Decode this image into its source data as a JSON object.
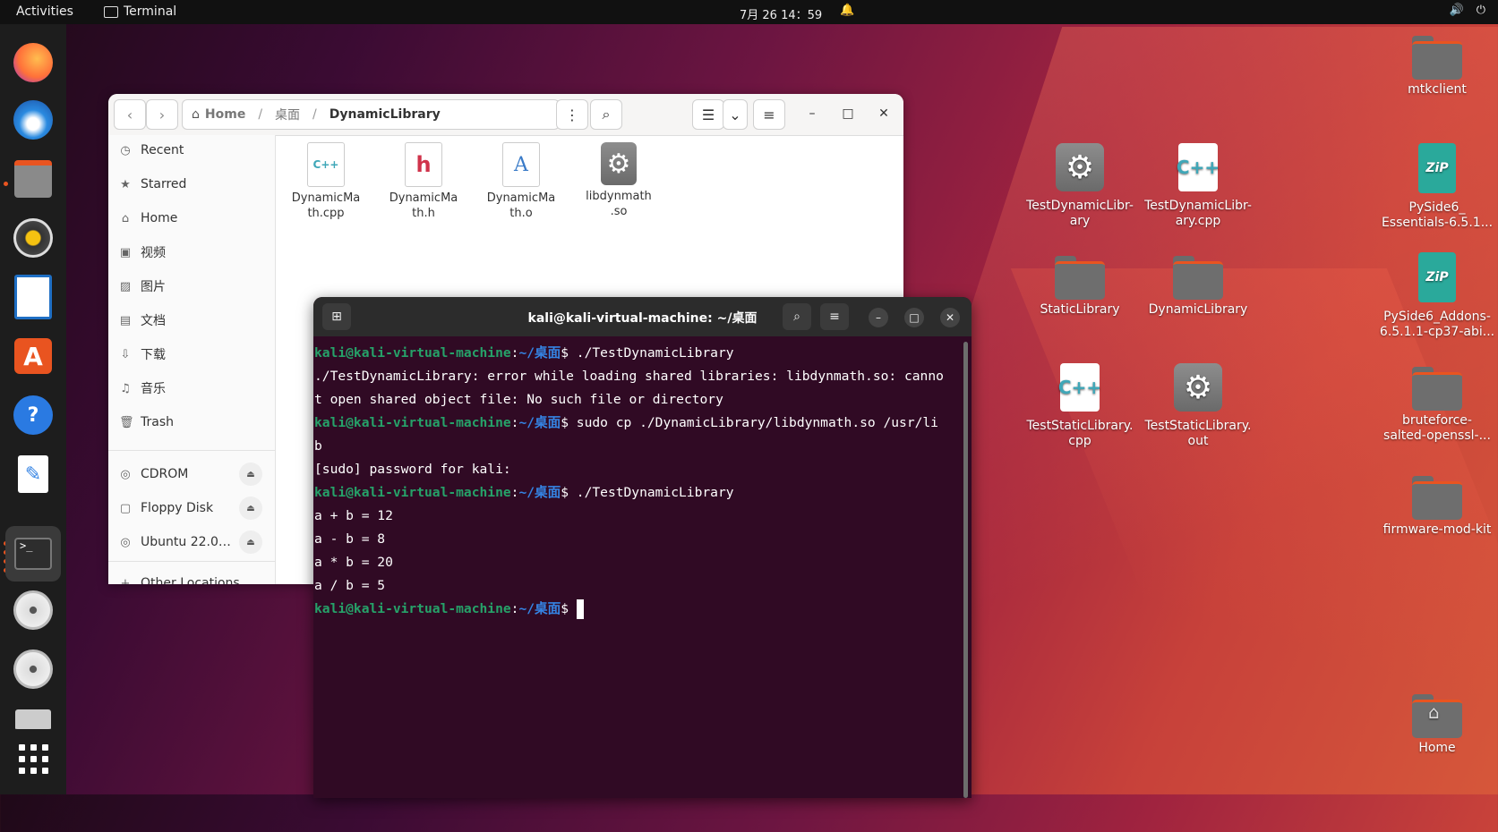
{
  "topbar": {
    "activities": "Activities",
    "app_name": "Terminal",
    "clock": "7月 26 14：59"
  },
  "dock": {
    "items": [
      "firefox-icon",
      "thunderbird-icon",
      "files-icon",
      "rhythmbox-icon",
      "writer-icon",
      "app-center-icon",
      "help-icon",
      "text-editor-icon",
      "terminal-icon",
      "cdrom-icon",
      "dvd-icon",
      "disk-icon",
      "show-apps-icon"
    ]
  },
  "files_window": {
    "path": {
      "home": "Home",
      "desktop": "桌面",
      "current": "DynamicLibrary"
    },
    "sidebar": {
      "recent": "Recent",
      "starred": "Starred",
      "home": "Home",
      "videos": "视频",
      "pictures": "图片",
      "documents": "文档",
      "downloads": "下载",
      "music": "音乐",
      "trash": "Trash",
      "cdrom": "CDROM",
      "floppy": "Floppy Disk",
      "ubuntu": "Ubuntu 22.0…",
      "other": "Other Locations"
    },
    "files": [
      {
        "line1": "DynamicMa",
        "line2": "th.cpp",
        "badge": "C++"
      },
      {
        "line1": "DynamicMa",
        "line2": "th.h",
        "badge": "h"
      },
      {
        "line1": "DynamicMa",
        "line2": "th.o",
        "badge": "A"
      },
      {
        "line1": "libdynmath",
        "line2": ".so",
        "badge": "⚙"
      }
    ]
  },
  "terminal": {
    "title": "kali@kali-virtual-machine: ~/桌面",
    "prompt_user": "kali@kali-virtual-machine",
    "prompt_path": "~/桌面",
    "lines": {
      "cmd1": " ./TestDynamicLibrary",
      "err1": "./TestDynamicLibrary: error while loading shared libraries: libdynmath.so: canno",
      "err2": "t open shared object file: No such file or directory",
      "cmd2": " sudo cp ./DynamicLibrary/libdynmath.so /usr/li",
      "cmd2b": "b",
      "sudo": "[sudo] password for kali:",
      "cmd3": " ./TestDynamicLibrary",
      "out1": "a + b = 12",
      "out2": "a - b = 8",
      "out3": "a * b = 20",
      "out4": "a / b = 5"
    }
  },
  "desktop": {
    "mtkclient": "mtkclient",
    "testdyn1": "TestDynamicLibr-",
    "testdyn2": "ary",
    "testdyncpp1": "TestDynamicLibr-",
    "testdyncpp2": "ary.cpp",
    "pyside_ess1": "PySide6_",
    "pyside_ess2": "Essentials-6.5.1...",
    "static": "StaticLibrary",
    "dynamic": "DynamicLibrary",
    "pyside_add1": "PySide6_Addons-",
    "pyside_add2": "6.5.1.1-cp37-abi...",
    "teststaticcpp1": "TestStaticLibrary.",
    "teststaticcpp2": "cpp",
    "teststaticout1": "TestStaticLibrary.",
    "teststaticout2": "out",
    "bruteforce1": "bruteforce-",
    "bruteforce2": "salted-openssl-...",
    "firmware": "firmware-mod-kit",
    "home": "Home",
    "zip_label": "ZiP",
    "cpp_label": "C++"
  }
}
